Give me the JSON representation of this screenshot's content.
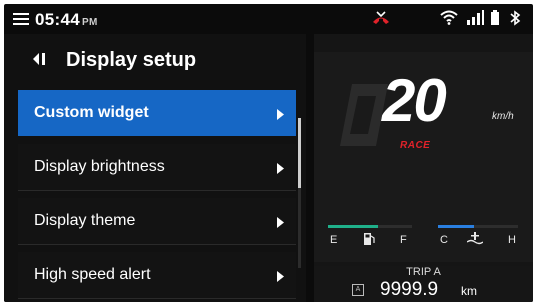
{
  "status_bar": {
    "time": "05:44",
    "ampm": "PM",
    "icons": [
      "menu-icon",
      "phone-missed-icon",
      "wifi-icon",
      "signal-icon",
      "battery-icon",
      "bluetooth-icon"
    ]
  },
  "menu": {
    "title": "Display setup",
    "items": [
      {
        "label": "Custom widget",
        "active": true
      },
      {
        "label": "Display brightness",
        "active": false
      },
      {
        "label": "Display theme",
        "active": false
      },
      {
        "label": "High speed alert",
        "active": false
      }
    ]
  },
  "dashboard": {
    "speed": "20",
    "speed_unit": "km/h",
    "mode": "RACE",
    "fuel_gauge": {
      "low_label": "E",
      "high_label": "F",
      "level": 0.6
    },
    "temp_gauge": {
      "low_label": "C",
      "high_label": "H",
      "level": 0.45
    },
    "trip": {
      "title": "TRIP A",
      "value": "9999.9",
      "unit": "km",
      "badge": "A"
    }
  },
  "colors": {
    "accent_blue": "#1667c5",
    "mode_red": "#e0222a",
    "fuel_green": "#1fb08a",
    "temp_blue": "#2a7fe0"
  }
}
